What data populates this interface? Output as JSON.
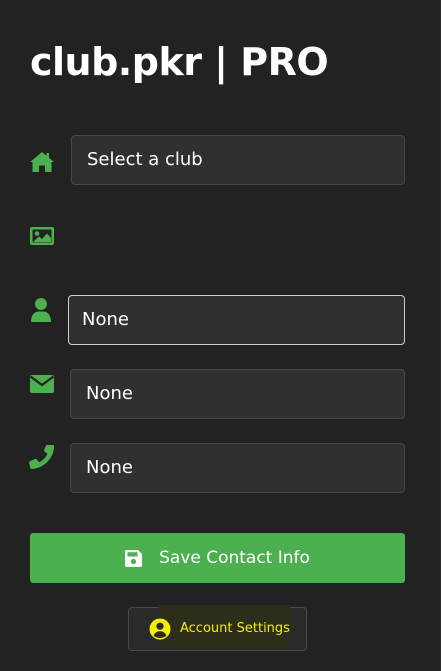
{
  "app": {
    "title": "club.pkr | PRO"
  },
  "form": {
    "club_select": {
      "value": "Select a club",
      "icon": "home-icon"
    },
    "image": {
      "icon": "image-icon"
    },
    "name": {
      "value": "None",
      "icon": "user-icon",
      "focused": true
    },
    "email": {
      "value": "None",
      "icon": "envelope-icon"
    },
    "phone": {
      "value": "None",
      "icon": "phone-icon"
    }
  },
  "actions": {
    "save_label": "Save Contact Info",
    "save_icon": "floppy-disk-icon",
    "account_label": "Account Settings",
    "account_icon": "user-circle-icon"
  },
  "colors": {
    "background": "#222222",
    "accent_green": "#4caf50",
    "highlight_yellow": "#f4f000"
  }
}
